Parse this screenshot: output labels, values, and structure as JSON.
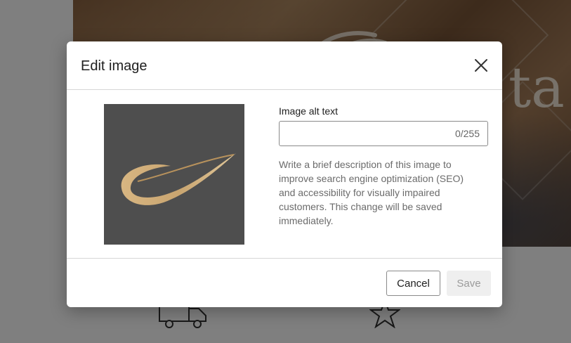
{
  "background": {
    "hero_text_fragment": "ta"
  },
  "dialog": {
    "title": "Edit image",
    "close_icon": "close-icon",
    "thumbnail_icon": "logo-swoosh",
    "field_label": "Image alt text",
    "input_value": "",
    "char_count": "0/255",
    "help_text": "Write a brief description of this image to improve search engine optimization (SEO) and accessibility for visually impaired customers. This change will be saved immediately.",
    "cancel_label": "Cancel",
    "save_label": "Save",
    "save_disabled": true
  },
  "colors": {
    "overlay": "#000000",
    "thumbnail_bg": "#4e4e4e",
    "logo_gold": "#c9a570",
    "save_disabled_bg": "#efefef"
  }
}
